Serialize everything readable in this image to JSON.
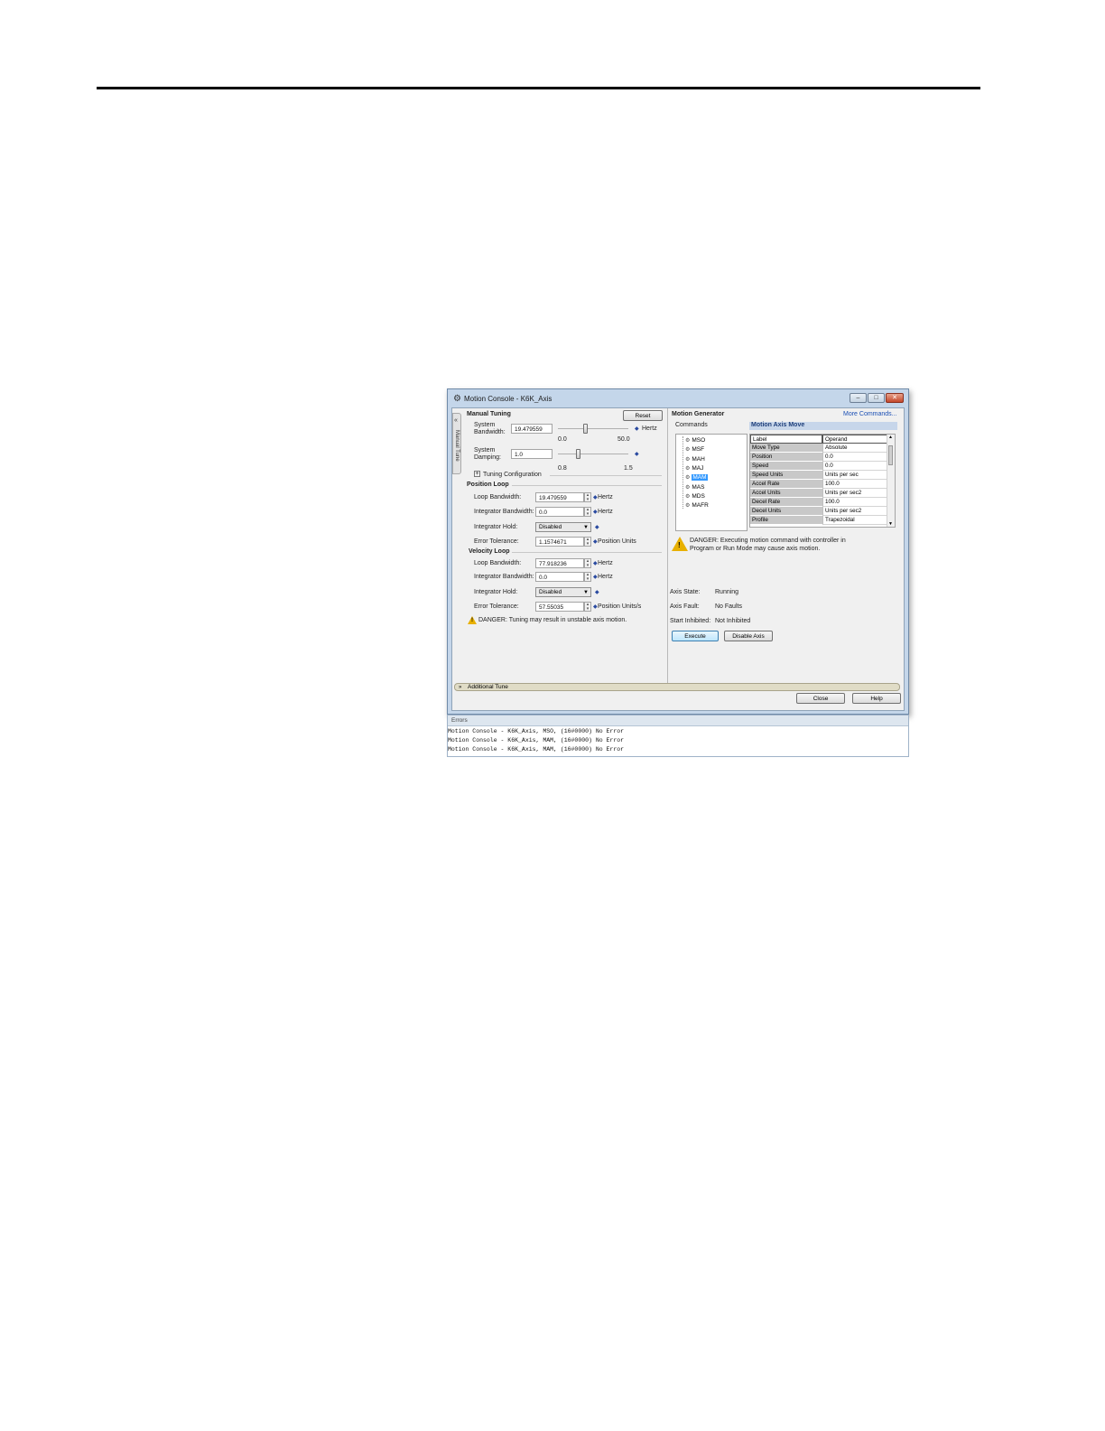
{
  "window": {
    "title": "Motion Console - K6K_Axis",
    "controls": {
      "minimize": "–",
      "maximize": "□",
      "close": "✕"
    }
  },
  "side_tab": {
    "label": "Manual Tune"
  },
  "manual_tuning": {
    "heading": "Manual Tuning",
    "reset_label": "Reset",
    "system_bandwidth": {
      "label": "System\nBandwidth:",
      "value": "19.479559",
      "unit": "Hertz",
      "min": "0.0",
      "max": "50.0",
      "level": 19.48
    },
    "system_damping": {
      "label": "System\nDamping:",
      "value": "1.0",
      "min": "0.8",
      "max": "1.5",
      "level": 1.0
    },
    "tuning_config_label": "Tuning Configuration",
    "tuning_config_toggle": "+"
  },
  "position_loop": {
    "heading": "Position Loop",
    "loop_bandwidth": {
      "label": "Loop Bandwidth:",
      "value": "19.479559",
      "unit": "Hertz"
    },
    "integrator_bandwidth": {
      "label": "Integrator Bandwidth:",
      "value": "0.0",
      "unit": "Hertz"
    },
    "integrator_hold": {
      "label": "Integrator Hold:",
      "value": "Disabled"
    },
    "error_tolerance": {
      "label": "Error Tolerance:",
      "value": "1.1574671",
      "unit": "Position Units"
    }
  },
  "velocity_loop": {
    "heading": "Velocity Loop",
    "loop_bandwidth": {
      "label": "Loop Bandwidth:",
      "value": "77.918236",
      "unit": "Hertz"
    },
    "integrator_bandwidth": {
      "label": "Integrator Bandwidth:",
      "value": "0.0",
      "unit": "Hertz"
    },
    "integrator_hold": {
      "label": "Integrator Hold:",
      "value": "Disabled"
    },
    "error_tolerance": {
      "label": "Error Tolerance:",
      "value": "57.55035",
      "unit": "Position Units/s"
    }
  },
  "tuning_danger": "DANGER: Tuning may result in unstable axis motion.",
  "motion_generator": {
    "heading": "Motion Generator",
    "more_commands": "More Commands...",
    "commands_label": "Commands",
    "commands": [
      "MSO",
      "MSF",
      "MAH",
      "MAJ",
      "MAM",
      "MAS",
      "MDS",
      "MAFR"
    ],
    "selected_command": "MAM",
    "grid_title": "Motion Axis Move",
    "grid_header": {
      "key": "Label",
      "value": "Operand"
    },
    "grid_rows": [
      {
        "key": "Move Type",
        "value": "Absolute"
      },
      {
        "key": "Position",
        "value": "0.0"
      },
      {
        "key": "Speed",
        "value": "0.0"
      },
      {
        "key": "Speed Units",
        "value": "Units per sec"
      },
      {
        "key": "Accel Rate",
        "value": "100.0"
      },
      {
        "key": "Accel Units",
        "value": "Units per sec2"
      },
      {
        "key": "Decel Rate",
        "value": "100.0"
      },
      {
        "key": "Decel Units",
        "value": "Units per sec2"
      },
      {
        "key": "Profile",
        "value": "Trapezoidal"
      }
    ],
    "danger_line1": "DANGER: Executing motion command with controller in",
    "danger_line2": "Program or Run Mode may cause axis motion.",
    "axis_state_label": "Axis State:",
    "axis_state": "Running",
    "axis_fault_label": "Axis Fault:",
    "axis_fault": "No Faults",
    "start_inhibited_label": "Start Inhibited:",
    "start_inhibited": "Not Inhibited",
    "execute_label": "Execute",
    "disable_axis_label": "Disable Axis"
  },
  "additional_tune": {
    "label": "Additional Tune",
    "icon": "double-chevron-down"
  },
  "footer": {
    "close_label": "Close",
    "help_label": "Help"
  },
  "errors": {
    "heading": "Errors",
    "lines": [
      "Motion Console - K6K_Axis, MSO, (16#0000) No Error",
      "Motion Console - K6K_Axis, MAM, (16#0000) No Error",
      "Motion Console - K6K_Axis, MAM, (16#0000) No Error"
    ]
  },
  "colors": {
    "accent": "#3399ff",
    "danger": "#e8b000",
    "window_frame": "#c4d6ea"
  }
}
